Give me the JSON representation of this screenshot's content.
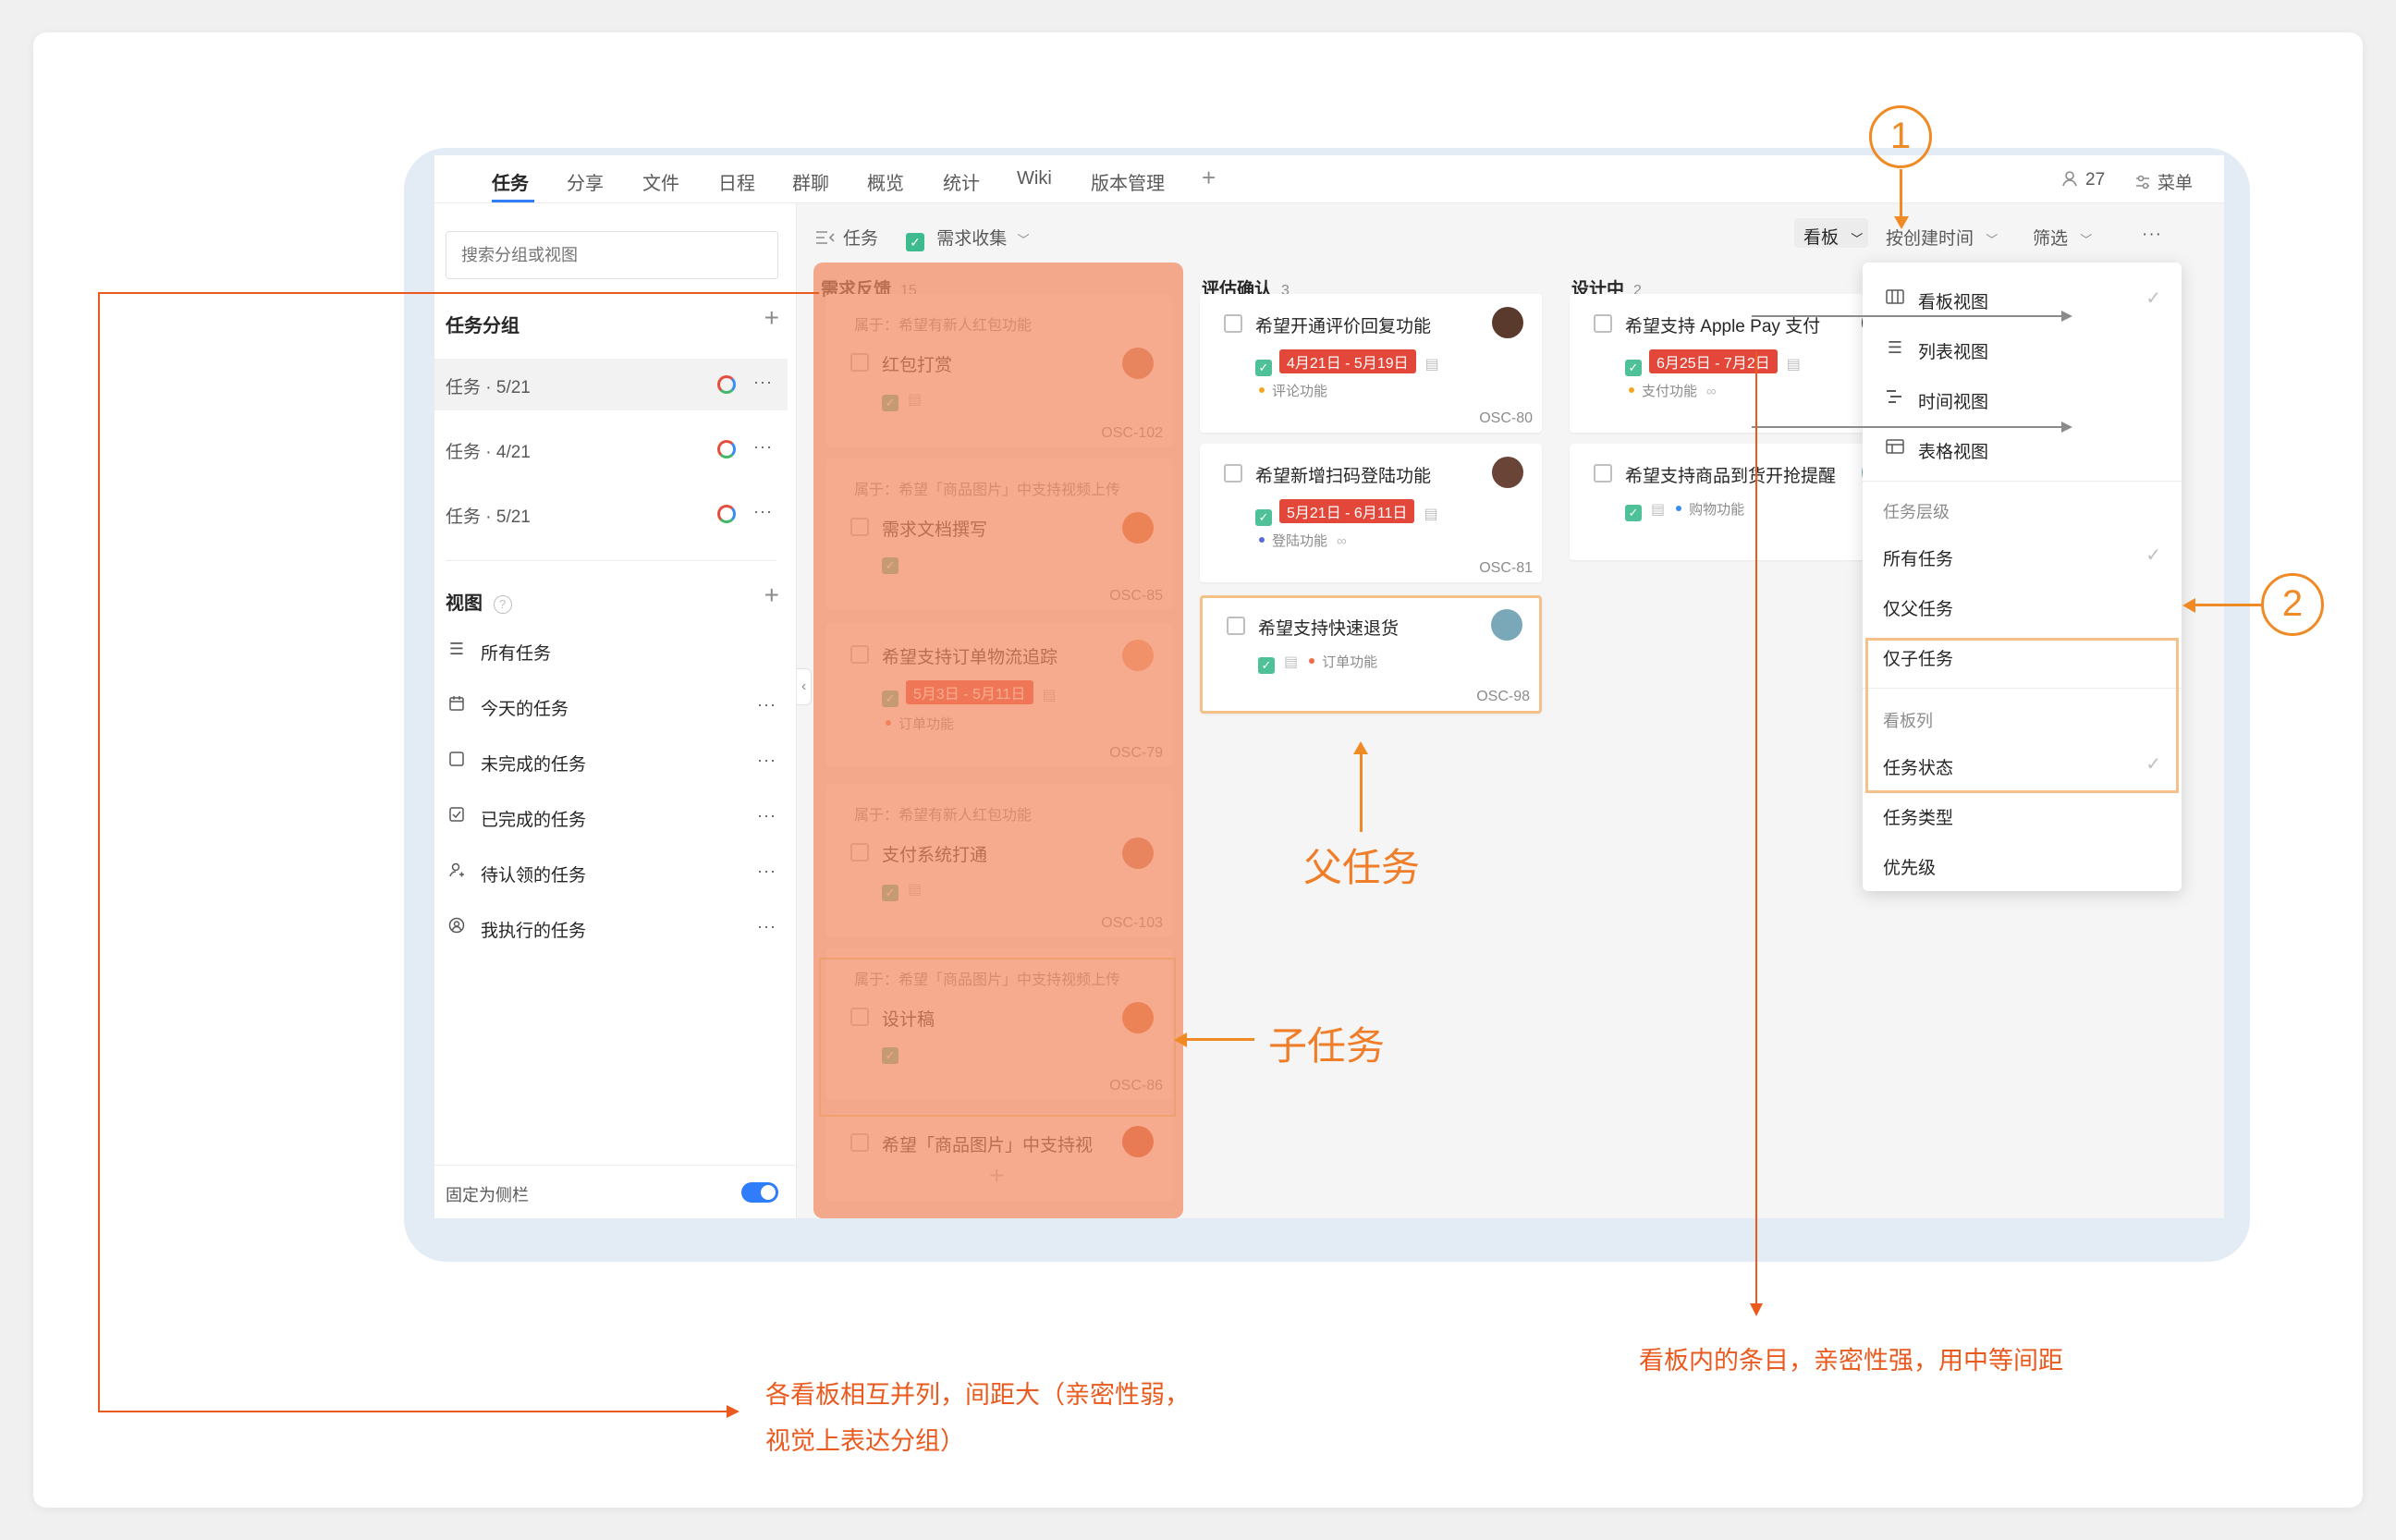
{
  "nav": {
    "tabs": [
      "任务",
      "分享",
      "文件",
      "日程",
      "群聊",
      "概览",
      "统计",
      "Wiki",
      "版本管理"
    ],
    "add": "+",
    "members_count": "27",
    "menu_label": "菜单"
  },
  "sidebar": {
    "search_placeholder": "搜索分组或视图",
    "groups_title": "任务分组",
    "groups": [
      {
        "label": "任务 · 5/21"
      },
      {
        "label": "任务 · 4/21"
      },
      {
        "label": "任务 · 5/21"
      }
    ],
    "views_title": "视图",
    "views": [
      {
        "label": "所有任务",
        "icon": "list-icon"
      },
      {
        "label": "今天的任务",
        "icon": "calendar-icon"
      },
      {
        "label": "未完成的任务",
        "icon": "checkbox-empty-icon"
      },
      {
        "label": "已完成的任务",
        "icon": "checkbox-checked-icon"
      },
      {
        "label": "待认领的任务",
        "icon": "user-claim-icon"
      },
      {
        "label": "我执行的任务",
        "icon": "user-circle-icon"
      }
    ],
    "pin_label": "固定为侧栏",
    "plus": "+",
    "more": "···"
  },
  "toolbar": {
    "breadcrumb_task": "任务",
    "breadcrumb_collection": "需求收集",
    "view_button": "看板",
    "sort_button": "按创建时间",
    "filter_button": "筛选",
    "more": "···"
  },
  "columns": [
    {
      "title": "需求反馈",
      "count": "15",
      "cards": [
        {
          "belong": "属于：希望有新人红包功能",
          "title": "红包打赏",
          "id": "OSC-102"
        },
        {
          "belong": "属于：希望「商品图片」中支持视频上传",
          "title": "需求文档撰写",
          "id": "OSC-85"
        },
        {
          "title": "希望支持订单物流追踪",
          "date": "5月3日 - 5月11日",
          "tag": "订单功能",
          "id": "OSC-79"
        },
        {
          "belong": "属于：希望有新人红包功能",
          "title": "支付系统打通",
          "id": "OSC-103"
        },
        {
          "belong": "属于：希望「商品图片」中支持视频上传",
          "title": "设计稿",
          "id": "OSC-86"
        },
        {
          "title": "希望「商品图片」中支持视"
        }
      ],
      "add": "+"
    },
    {
      "title": "评估确认",
      "count": "3",
      "cards": [
        {
          "title": "希望开通评价回复功能",
          "date": "4月21日 - 5月19日",
          "tag": "评论功能",
          "id": "OSC-80"
        },
        {
          "title": "希望新增扫码登陆功能",
          "date": "5月21日 - 6月11日",
          "tag": "登陆功能",
          "id": "OSC-81"
        },
        {
          "title": "希望支持快速退货",
          "tag": "订单功能",
          "id": "OSC-98"
        }
      ]
    },
    {
      "title": "设计中",
      "count": "2",
      "cards": [
        {
          "title": "希望支持 Apple Pay 支付",
          "date": "6月25日 - 7月2日",
          "tag": "支付功能",
          "id": "OS"
        },
        {
          "title": "希望支持商品到货开抢提醒",
          "tag": "购物功能",
          "id": "OS"
        }
      ]
    }
  ],
  "dropdown": {
    "views": [
      {
        "label": "看板视图",
        "checked": true,
        "icon": "kanban-icon"
      },
      {
        "label": "列表视图",
        "icon": "list-icon"
      },
      {
        "label": "时间视图",
        "icon": "timeline-icon"
      },
      {
        "label": "表格视图",
        "icon": "table-icon"
      }
    ],
    "level_title": "任务层级",
    "levels": [
      {
        "label": "所有任务",
        "checked": true
      },
      {
        "label": "仅父任务"
      },
      {
        "label": "仅子任务"
      }
    ],
    "column_title": "看板列",
    "columns": [
      {
        "label": "任务状态",
        "checked": true
      },
      {
        "label": "任务类型"
      },
      {
        "label": "优先级"
      }
    ],
    "check": "✓"
  },
  "annotations": {
    "marker1": "1",
    "marker2": "2",
    "parent_task": "父任务",
    "child_task": "子任务",
    "columns_note_line1": "各看板相互并列，间距大（亲密性弱，",
    "columns_note_line2": "视觉上表达分组）",
    "items_note": "看板内的条目，亲密性强，用中等间距"
  },
  "colors": {
    "accent_blue": "#2f7dfa",
    "highlight_orange": "#f48a62",
    "annotation_orange": "#f07d28",
    "date_red": "#e2473a",
    "check_green": "#3dbb8f"
  }
}
